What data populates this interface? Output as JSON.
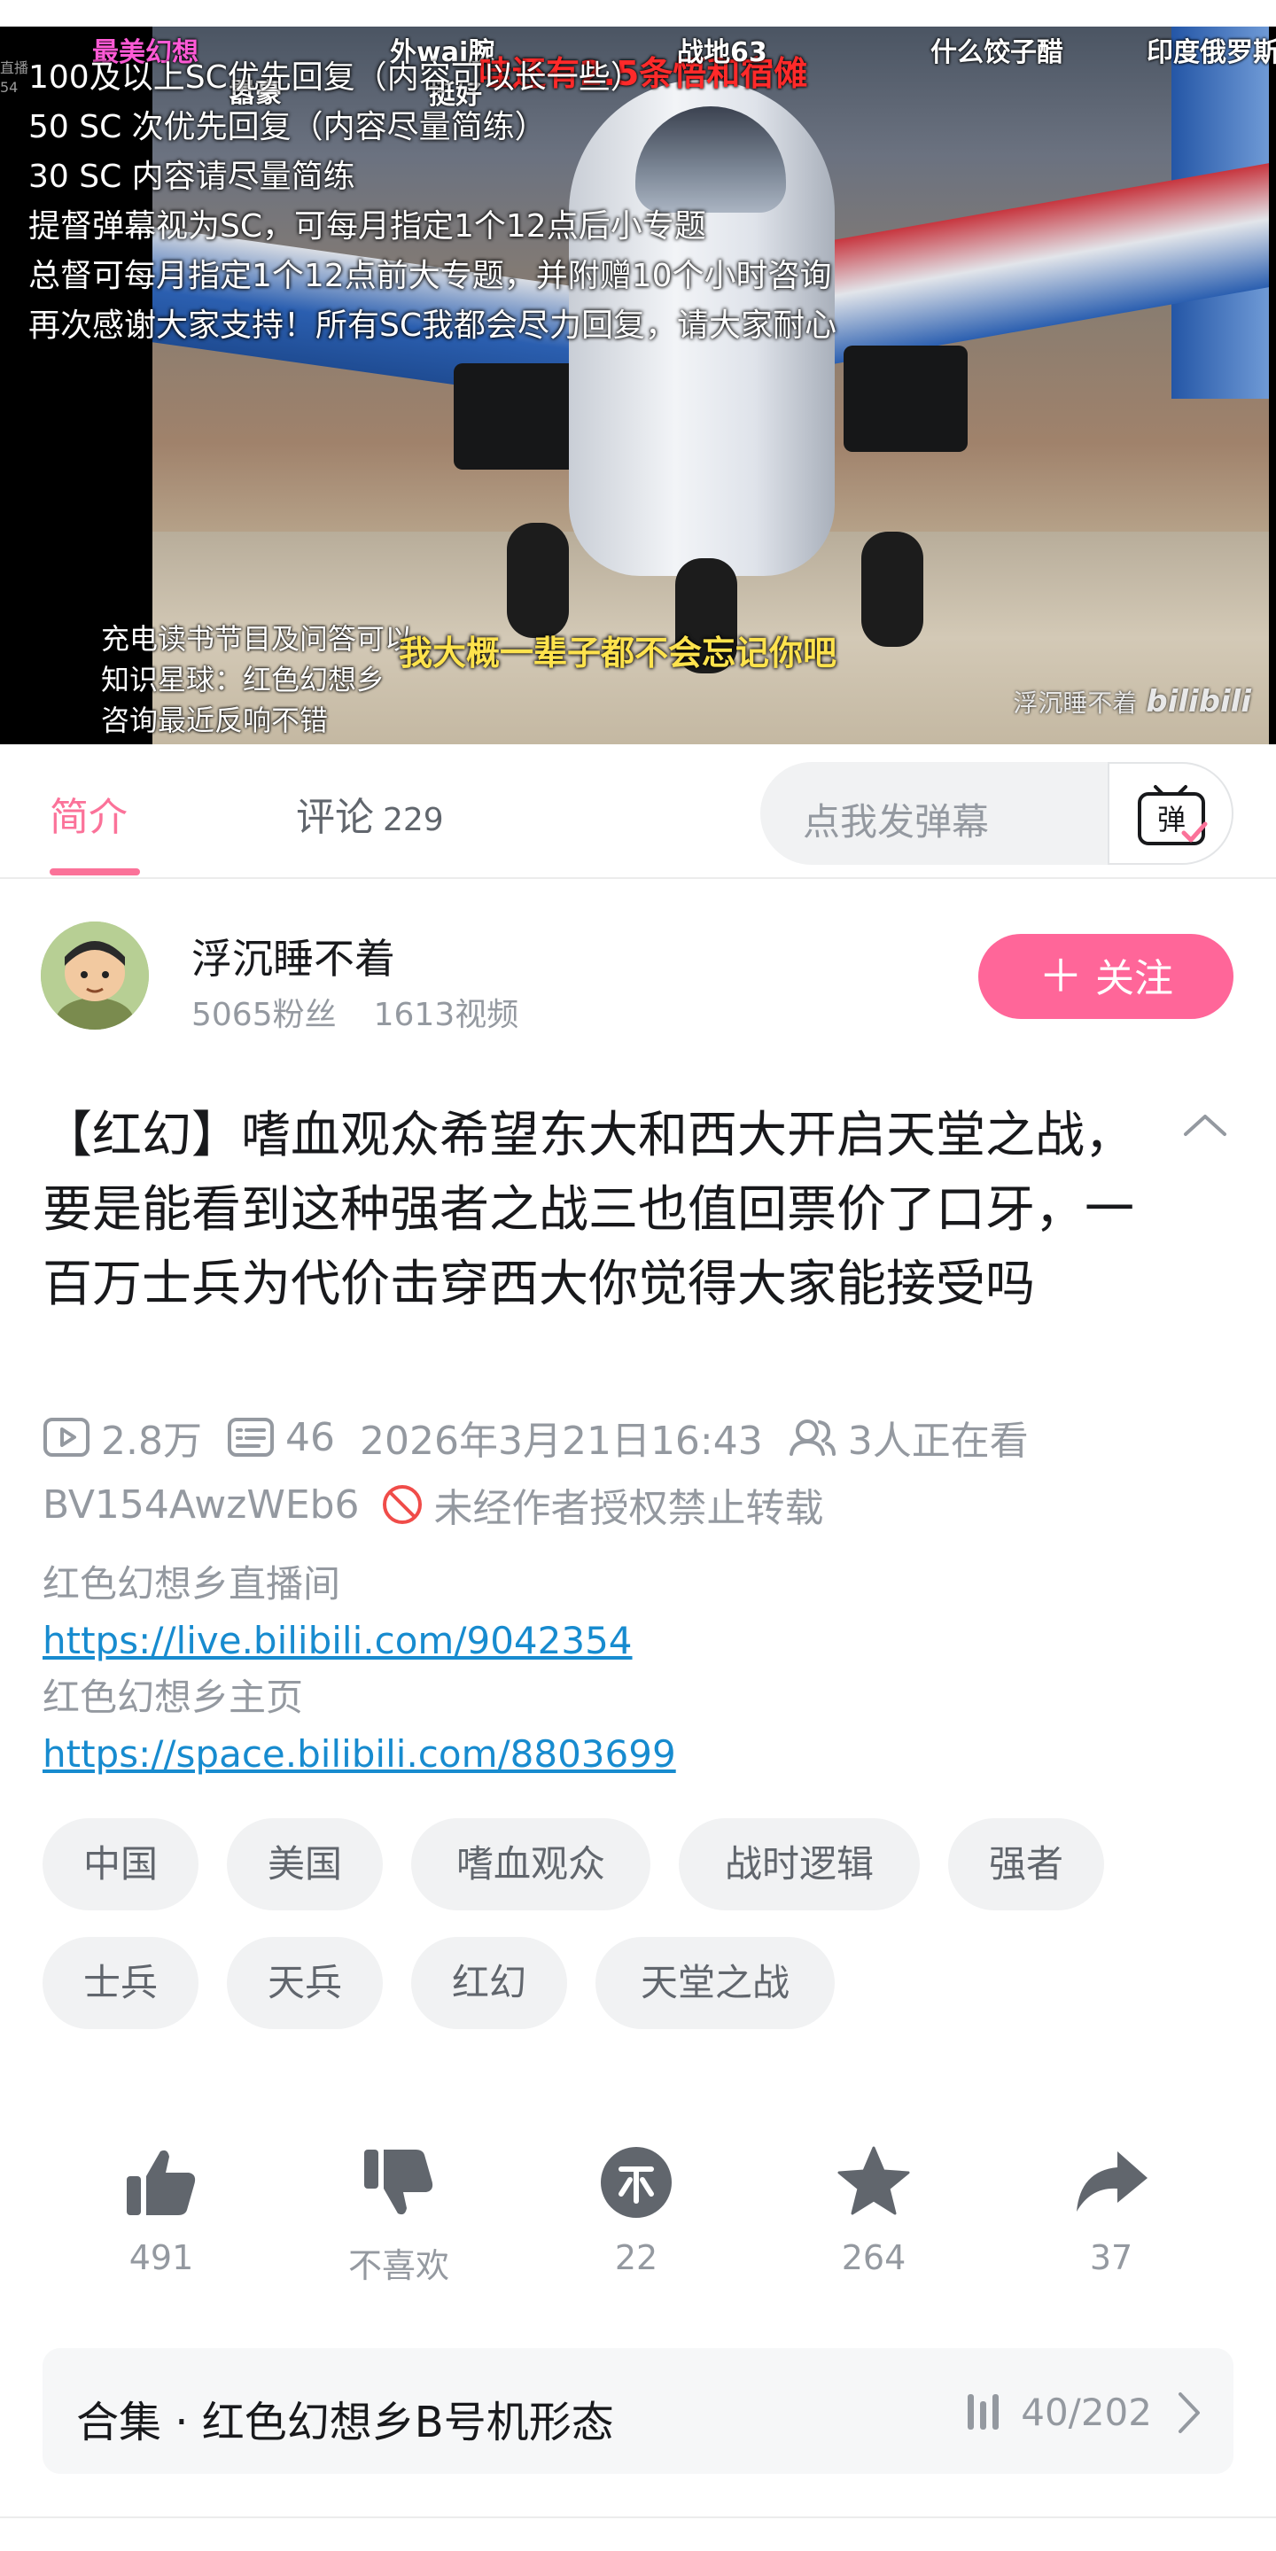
{
  "player": {
    "danmaku": [
      {
        "text": "最美幻想",
        "color": "#ff5ad6"
      },
      {
        "text": "外wai腕",
        "color": "#ffffff"
      },
      {
        "text": "哇还有2.5条悟和宿傩",
        "color": "#ff2a2a"
      },
      {
        "text": "战地63",
        "color": "#ffffff"
      },
      {
        "text": "什么饺子醋",
        "color": "#ffffff"
      },
      {
        "text": "印度俄罗斯",
        "color": "#ffffff"
      },
      {
        "text": "嚣豪",
        "color": "#ffffff"
      },
      {
        "text": "挺好",
        "color": "#ffffff"
      }
    ],
    "overlay_lines": [
      "100及以上SC优先回复（内容可以长一些）",
      "50 SC 次优先回复（内容尽量简练）",
      "30 SC 内容请尽量简练",
      "提督弹幕视为SC，可每月指定1个12点后小专题",
      "总督可每月指定1个12点前大专题，并附赠10个小时咨询",
      "再次感谢大家支持！所有SC我都会尽力回复，请大家耐心"
    ],
    "side_small": [
      "直播",
      "54"
    ],
    "left_notes": [
      "充电读书节目及问答可以",
      "知识星球：红色幻想乡",
      "咨询最近反响不错"
    ],
    "subtitle": "我大概一辈子都不会忘记你吧",
    "watermark_name": "浮沉睡不着",
    "watermark_logo": "bilibili",
    "progress_fraction": 0.2
  },
  "tabs": {
    "intro_label": "简介",
    "comments_label": "评论",
    "comments_count": "229",
    "danmaku_placeholder": "点我发弹幕",
    "danmaku_button": "弹"
  },
  "uploader": {
    "name": "浮沉睡不着",
    "fans": "5065粉丝",
    "videos": "1613视频",
    "follow_label": "关注"
  },
  "video": {
    "title": "【红幻】嗜血观众希望东大和西大开启天堂之战，要是能看到这种强者之战三也值回票价了口牙，一百万士兵为代价击穿西大你觉得大家能接受吗",
    "views": "2.8万",
    "danmaku_count": "46",
    "date": "2026年3月21日16:43",
    "watching": "3人正在看",
    "bvid": "BV154AwzWEb6",
    "no_repost": "未经作者授权禁止转载",
    "desc_line1": "红色幻想乡直播间",
    "desc_link1": "https://live.bilibili.com/9042354",
    "desc_line2": "红色幻想乡主页",
    "desc_link2": "https://space.bilibili.com/8803699"
  },
  "tags": [
    "中国",
    "美国",
    "嗜血观众",
    "战时逻辑",
    "强者",
    "士兵",
    "天兵",
    "红幻",
    "天堂之战"
  ],
  "actions": {
    "like": "491",
    "dislike": "不喜欢",
    "coin": "22",
    "favorite": "264",
    "share": "37"
  },
  "collection": {
    "name": "合集 · 红色幻想乡B号机形态",
    "progress": "40/202"
  },
  "colors": {
    "accent_pink": "#fb7299",
    "follow_pink": "#ff6699",
    "link_blue": "#178bcf",
    "ban_red": "#f04c49"
  }
}
